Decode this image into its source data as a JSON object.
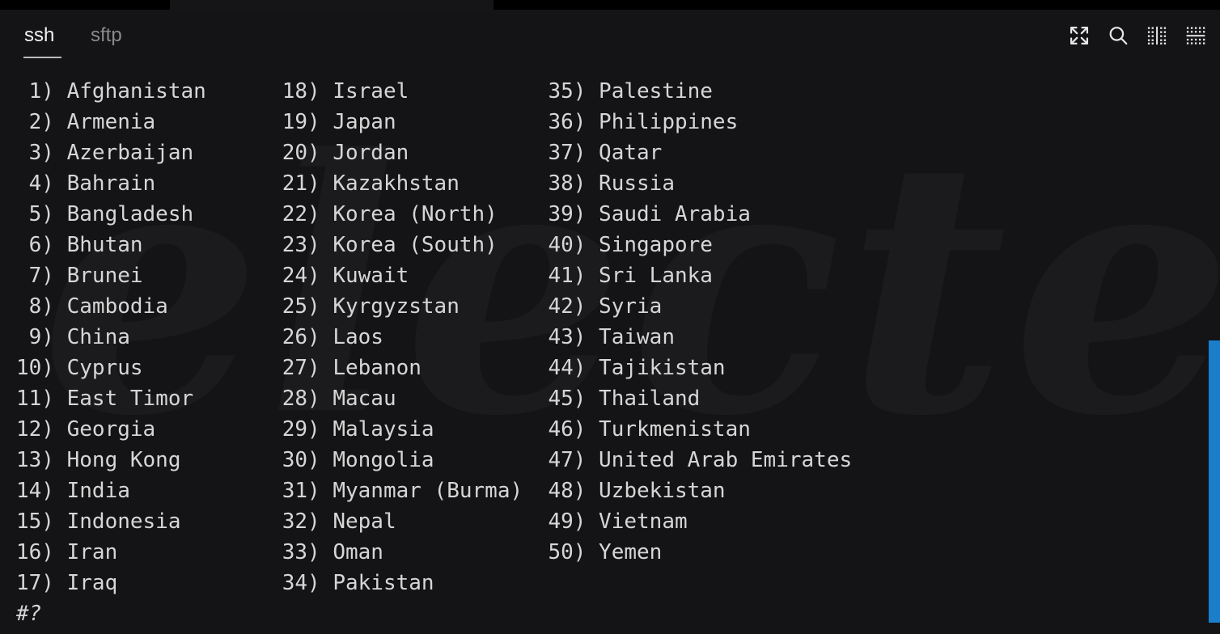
{
  "window": {
    "background_color": "#141416",
    "text_color": "#d6d6d6",
    "accent_color": "#1a7ecb"
  },
  "watermark": {
    "text": "electerm"
  },
  "tabs": [
    {
      "id": "ssh",
      "label": "ssh",
      "active": true
    },
    {
      "id": "sftp",
      "label": "sftp",
      "active": false
    }
  ],
  "toolbar": {
    "icons": [
      {
        "name": "expand-icon",
        "title": "Fullscreen"
      },
      {
        "name": "search-icon",
        "title": "Search"
      },
      {
        "name": "split-vertical-icon",
        "title": "Split vertically"
      },
      {
        "name": "split-horizontal-icon",
        "title": "Split horizontally"
      }
    ]
  },
  "terminal": {
    "prompt": "#?",
    "columns": 3,
    "items": [
      {
        "num": "1",
        "name": "Afghanistan"
      },
      {
        "num": "2",
        "name": "Armenia"
      },
      {
        "num": "3",
        "name": "Azerbaijan"
      },
      {
        "num": "4",
        "name": "Bahrain"
      },
      {
        "num": "5",
        "name": "Bangladesh"
      },
      {
        "num": "6",
        "name": "Bhutan"
      },
      {
        "num": "7",
        "name": "Brunei"
      },
      {
        "num": "8",
        "name": "Cambodia"
      },
      {
        "num": "9",
        "name": "China"
      },
      {
        "num": "10",
        "name": "Cyprus"
      },
      {
        "num": "11",
        "name": "East Timor"
      },
      {
        "num": "12",
        "name": "Georgia"
      },
      {
        "num": "13",
        "name": "Hong Kong"
      },
      {
        "num": "14",
        "name": "India"
      },
      {
        "num": "15",
        "name": "Indonesia"
      },
      {
        "num": "16",
        "name": "Iran"
      },
      {
        "num": "17",
        "name": "Iraq"
      },
      {
        "num": "18",
        "name": "Israel"
      },
      {
        "num": "19",
        "name": "Japan"
      },
      {
        "num": "20",
        "name": "Jordan"
      },
      {
        "num": "21",
        "name": "Kazakhstan"
      },
      {
        "num": "22",
        "name": "Korea (North)"
      },
      {
        "num": "23",
        "name": "Korea (South)"
      },
      {
        "num": "24",
        "name": "Kuwait"
      },
      {
        "num": "25",
        "name": "Kyrgyzstan"
      },
      {
        "num": "26",
        "name": "Laos"
      },
      {
        "num": "27",
        "name": "Lebanon"
      },
      {
        "num": "28",
        "name": "Macau"
      },
      {
        "num": "29",
        "name": "Malaysia"
      },
      {
        "num": "30",
        "name": "Mongolia"
      },
      {
        "num": "31",
        "name": "Myanmar (Burma)"
      },
      {
        "num": "32",
        "name": "Nepal"
      },
      {
        "num": "33",
        "name": "Oman"
      },
      {
        "num": "34",
        "name": "Pakistan"
      },
      {
        "num": "35",
        "name": "Palestine"
      },
      {
        "num": "36",
        "name": "Philippines"
      },
      {
        "num": "37",
        "name": "Qatar"
      },
      {
        "num": "38",
        "name": "Russia"
      },
      {
        "num": "39",
        "name": "Saudi Arabia"
      },
      {
        "num": "40",
        "name": "Singapore"
      },
      {
        "num": "41",
        "name": "Sri Lanka"
      },
      {
        "num": "42",
        "name": "Syria"
      },
      {
        "num": "43",
        "name": "Taiwan"
      },
      {
        "num": "44",
        "name": "Tajikistan"
      },
      {
        "num": "45",
        "name": "Thailand"
      },
      {
        "num": "46",
        "name": "Turkmenistan"
      },
      {
        "num": "47",
        "name": "United Arab Emirates"
      },
      {
        "num": "48",
        "name": "Uzbekistan"
      },
      {
        "num": "49",
        "name": "Vietnam"
      },
      {
        "num": "50",
        "name": "Yemen"
      }
    ]
  },
  "scrollbar": {
    "orientation": "vertical",
    "thumb_color": "#1a7ecb"
  }
}
